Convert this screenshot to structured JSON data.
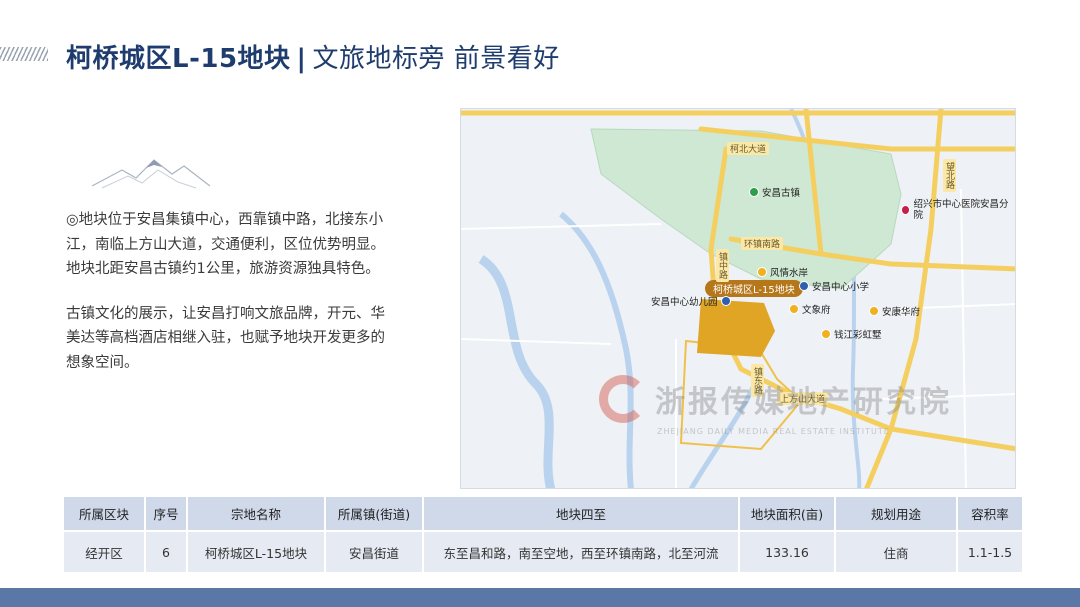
{
  "header": {
    "title_main": "柯桥城区L-15地块",
    "separator": "|",
    "title_sub": "文旅地标旁  前景看好"
  },
  "description": {
    "para1": "◎地块位于安昌集镇中心，西靠镇中路，北接东小江，南临上方山大道，交通便利，区位优势明显。地块北距安昌古镇约1公里，旅游资源独具特色。",
    "para2": "古镇文化的展示，让安昌打响文旅品牌，开元、华美达等高档酒店相继入驻，也赋予地块开发更多的想象空间。"
  },
  "map": {
    "plot_label": "柯桥城区L-15地块",
    "roads": {
      "r1": "柯北大道",
      "r2": "环镇南路",
      "r3": "镇中路",
      "r4": "上方山大道",
      "r5": "望北路",
      "r6": "镇东路"
    },
    "pois": [
      {
        "label": "安昌古镇",
        "color": "green"
      },
      {
        "label": "绍兴市中心医院安昌分院",
        "color": "red"
      },
      {
        "label": "风情水岸",
        "color": "yellow"
      },
      {
        "label": "安昌中心小学",
        "color": "blue"
      },
      {
        "label": "安昌中心幼儿园",
        "color": "blue"
      },
      {
        "label": "文象府",
        "color": "yellow"
      },
      {
        "label": "安康华府",
        "color": "yellow"
      },
      {
        "label": "钱江彩虹墅",
        "color": "yellow"
      }
    ],
    "watermark": {
      "cn": "浙报传媒地产研究院",
      "en": "ZHEJIANG DAILY MEDIA REAL ESTATE INSTITUTE"
    }
  },
  "table": {
    "headers": [
      "所属区块",
      "序号",
      "宗地名称",
      "所属镇(街道)",
      "地块四至",
      "地块面积(亩)",
      "规划用途",
      "容积率"
    ],
    "rows": [
      [
        "经开区",
        "6",
        "柯桥城区L-15地块",
        "安昌街道",
        "东至昌和路，南至空地，西至环镇南路，北至河流",
        "133.16",
        "住商",
        "1.1-1.5"
      ]
    ]
  },
  "colors": {
    "title": "#1f3c6e",
    "header_cell": "#cfd9ea",
    "body_cell": "#e6ebf3",
    "bottom_bar": "#5b77a6",
    "plot": "#e0a525",
    "green_area": "#cfe8d3"
  }
}
